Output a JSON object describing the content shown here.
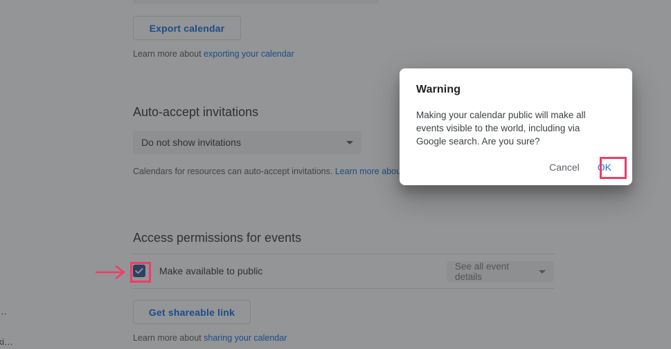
{
  "page": {
    "export_button_label": "Export calendar",
    "export_helper_prefix": "Learn more about ",
    "export_helper_link": "exporting your calendar",
    "autoaccept_title": "Auto-accept invitations",
    "autoaccept_selected": "Do not show invitations",
    "autoaccept_helper_prefix": "Calendars for resources can auto-accept invitations. ",
    "autoaccept_helper_link": "Learn more about a",
    "access_title": "Access permissions for events",
    "make_public_label": "Make available to public",
    "event_details_selected": "See all event details",
    "get_shareable_link_label": "Get shareable link",
    "sharing_helper_prefix": "Learn more about ",
    "sharing_helper_link": "sharing your calendar",
    "edge_fragment_a": "ut…",
    "edge_fragment_b": "ski…",
    "edge_fragment_link": "e"
  },
  "dialog": {
    "title": "Warning",
    "message": "Making your calendar public will make all events visible to the world, including via Google search. Are you sure?",
    "cancel_label": "Cancel",
    "ok_label": "OK"
  },
  "colors": {
    "accent_blue": "#1a73e8",
    "annotation_pink": "#f23b66",
    "checkbox_fill": "#3c5a9a",
    "scrim": "rgba(32,33,36,0.48)"
  }
}
